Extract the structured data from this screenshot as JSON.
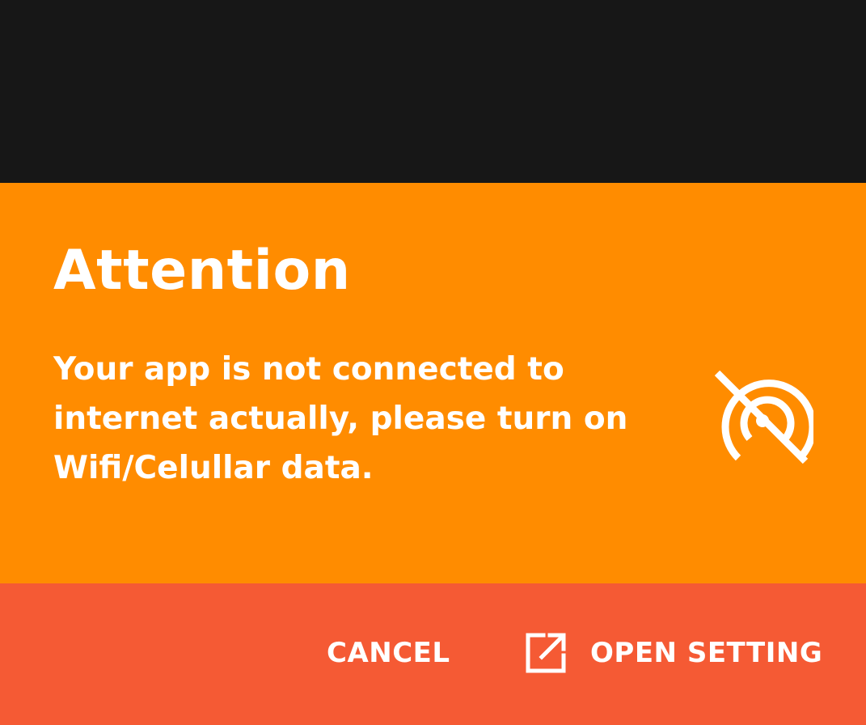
{
  "dialog": {
    "title": "Attention",
    "message": "Your app is not connected to internet actually, please turn on Wifi/Celullar data.",
    "status_icon": "wifi-off-icon",
    "actions": {
      "cancel_label": "CANCEL",
      "open_setting_label": "OPEN SETTING",
      "open_setting_icon": "open-in-new-icon"
    }
  },
  "colors": {
    "top_background": "#171717",
    "dialog_background": "#FF8C00",
    "actions_background": "#F55A34",
    "text": "#FFFFFF"
  }
}
